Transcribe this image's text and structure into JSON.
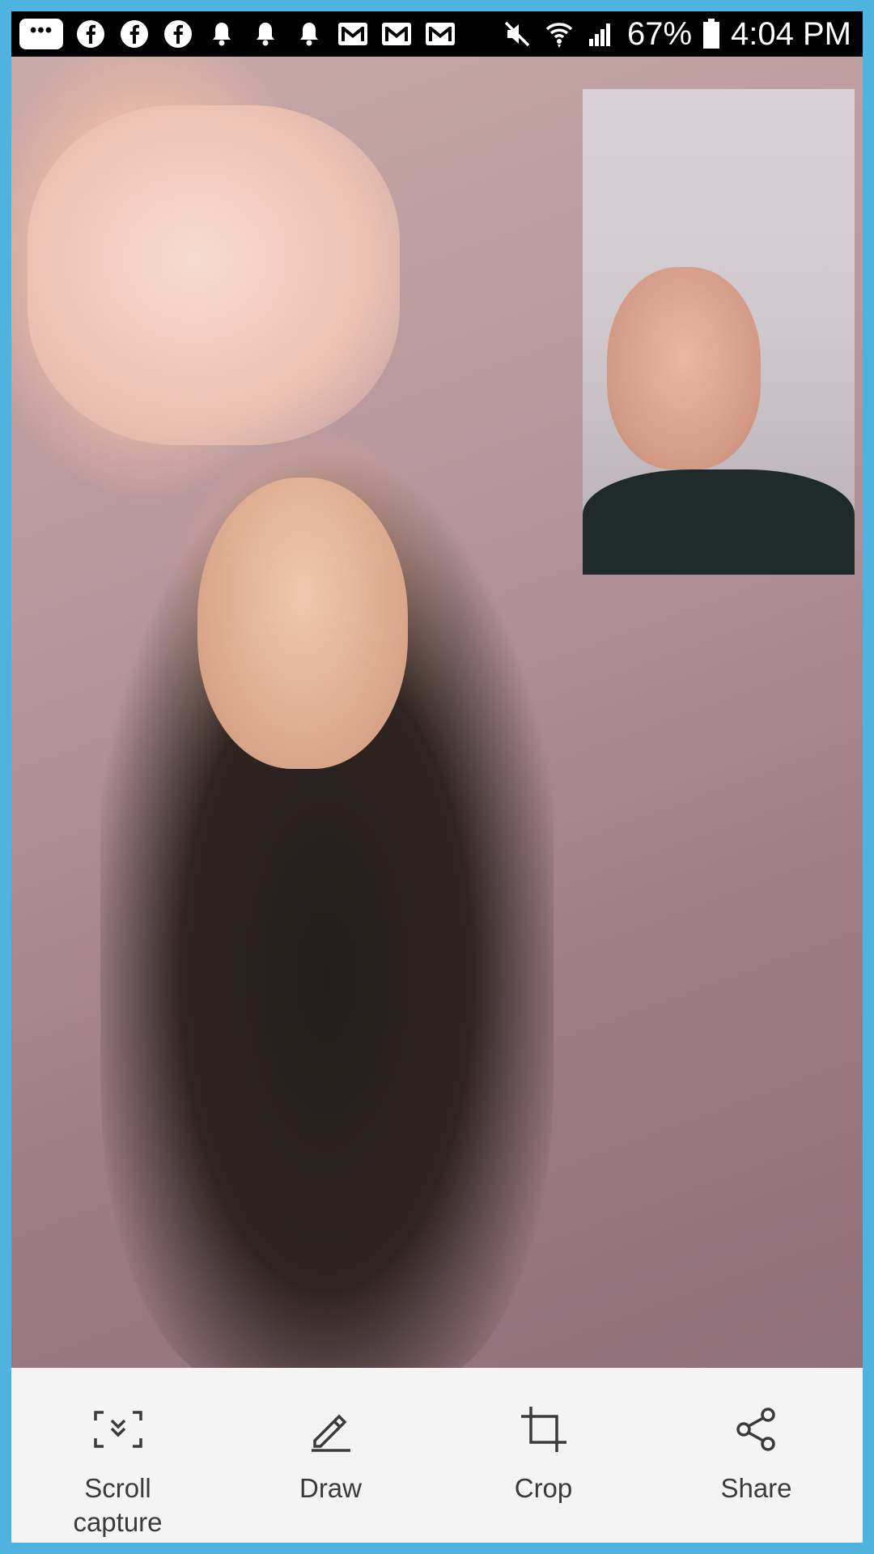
{
  "status_bar": {
    "more_icon_label": "•••",
    "battery_percent": "67%",
    "time": "4:04 PM",
    "left_icons": [
      "facebook-icon",
      "facebook-icon",
      "facebook-icon",
      "bell-icon",
      "bell-icon",
      "bell-icon",
      "mail-icon",
      "mail-icon",
      "mail-icon"
    ],
    "right_icons": [
      "mute-icon",
      "wifi-icon",
      "signal-icon",
      "battery-icon"
    ]
  },
  "toolbar": {
    "scroll_capture_label": "Scroll\ncapture",
    "draw_label": "Draw",
    "crop_label": "Crop",
    "share_label": "Share",
    "icon_color": "#3a3a3a"
  },
  "colors": {
    "border": "#4fb3e0",
    "statusbar_bg": "#000000",
    "toolbar_bg": "#f4f4f4"
  }
}
